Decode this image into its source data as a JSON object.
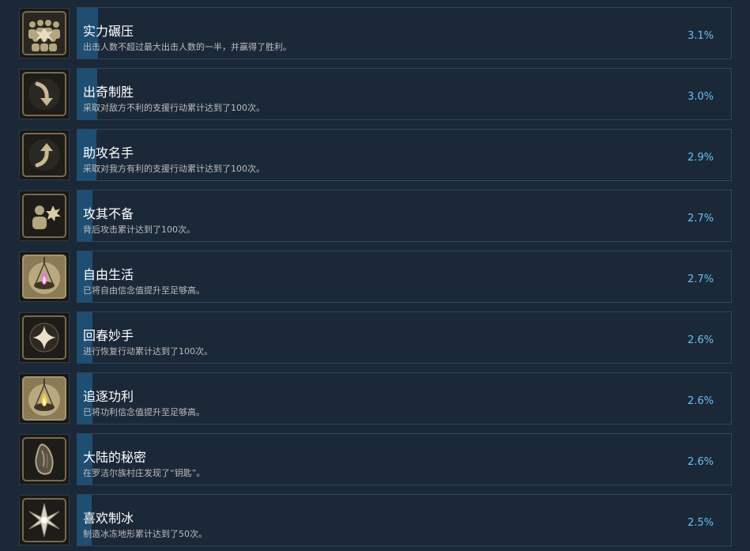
{
  "achievements": [
    {
      "title": "实力碾压",
      "desc": "出击人数不超过最大出击人数的一半，并赢得了胜利。",
      "pct": "3.1%",
      "progress": 0.031,
      "icon": "crowd-burst-icon"
    },
    {
      "title": "出奇制胜",
      "desc": "采取对敌方不利的支援行动累计达到了100次。",
      "pct": "3.0%",
      "progress": 0.03,
      "icon": "arrow-down-curve-icon"
    },
    {
      "title": "助攻名手",
      "desc": "采取对我方有利的支援行动累计达到了100次。",
      "pct": "2.9%",
      "progress": 0.029,
      "icon": "arrow-up-curve-icon"
    },
    {
      "title": "攻其不备",
      "desc": "背后攻击累计达到了100次。",
      "pct": "2.7%",
      "progress": 0.027,
      "icon": "person-burst-icon"
    },
    {
      "title": "自由生活",
      "desc": "已将自由信念值提升至足够高。",
      "pct": "2.7%",
      "progress": 0.027,
      "icon": "pink-flame-lamp-icon"
    },
    {
      "title": "回春妙手",
      "desc": "进行恢复行动累计达到了100次。",
      "pct": "2.6%",
      "progress": 0.026,
      "icon": "sparkle-icon"
    },
    {
      "title": "追逐功利",
      "desc": "已将功利信念值提升至足够高。",
      "pct": "2.6%",
      "progress": 0.026,
      "icon": "gold-flame-lamp-icon"
    },
    {
      "title": "大陆的秘密",
      "desc": "在罗洁尔族村庄发现了“钥匙”。",
      "pct": "2.6%",
      "progress": 0.026,
      "icon": "stone-icon"
    },
    {
      "title": "喜欢制冰",
      "desc": "制造冰冻地形累计达到了50次。",
      "pct": "2.5%",
      "progress": 0.025,
      "icon": "ice-star-icon"
    }
  ]
}
